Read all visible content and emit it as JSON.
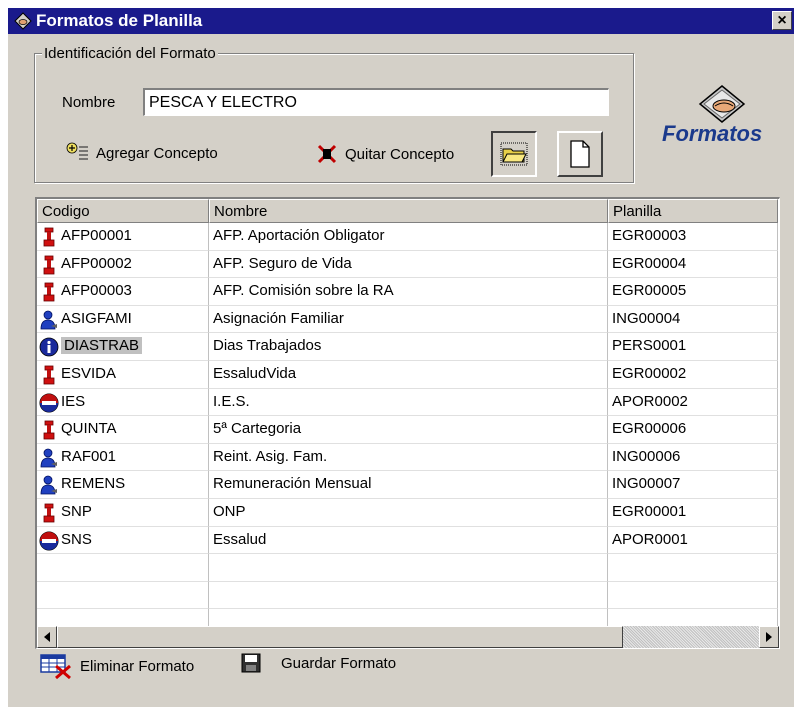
{
  "window": {
    "title": "Formatos de Planilla",
    "close_label": "×"
  },
  "identification": {
    "legend": "Identificación del Formato",
    "name_label": "Nombre",
    "name_value": "PESCA Y ELECTRO",
    "add_concept": "Agregar Concepto",
    "remove_concept": "Quitar Concepto"
  },
  "brand": {
    "text": "Formatos"
  },
  "grid": {
    "columns": [
      "Codigo",
      "Nombre",
      "Planilla"
    ],
    "rows": [
      {
        "icon": "red-marker-icon",
        "code": "AFP00001",
        "name": "AFP. Aportación Obligator",
        "planilla": "EGR00003"
      },
      {
        "icon": "red-marker-icon",
        "code": "AFP00002",
        "name": "AFP. Seguro de Vida",
        "planilla": "EGR00004"
      },
      {
        "icon": "red-marker-icon",
        "code": "AFP00003",
        "name": "AFP. Comisión sobre la RA",
        "planilla": "EGR00005"
      },
      {
        "icon": "person-icon",
        "code": "ASIGFAMI",
        "name": "Asignación Familiar",
        "planilla": "ING00004"
      },
      {
        "icon": "info-icon",
        "code": "DIASTRAB",
        "name": "Dias Trabajados",
        "planilla": "PERS0001",
        "selected": true
      },
      {
        "icon": "red-marker-icon",
        "code": "ESVIDA",
        "name": "EssaludVida",
        "planilla": "EGR00002"
      },
      {
        "icon": "contribution-icon",
        "code": "IES",
        "name": "I.E.S.",
        "planilla": "APOR0002"
      },
      {
        "icon": "red-marker-icon",
        "code": "QUINTA",
        "name": "5ª Cartegoria",
        "planilla": "EGR00006"
      },
      {
        "icon": "person-icon",
        "code": "RAF001",
        "name": "Reint. Asig. Fam.",
        "planilla": "ING00006"
      },
      {
        "icon": "person-icon",
        "code": "REMENS",
        "name": "Remuneración Mensual",
        "planilla": "ING00007"
      },
      {
        "icon": "red-marker-icon",
        "code": "SNP",
        "name": "ONP",
        "planilla": "EGR00001"
      },
      {
        "icon": "contribution-icon",
        "code": "SNS",
        "name": "Essalud",
        "planilla": "APOR0001"
      }
    ]
  },
  "footer": {
    "delete_format": "Eliminar Formato",
    "save_format": "Guardar Formato"
  }
}
